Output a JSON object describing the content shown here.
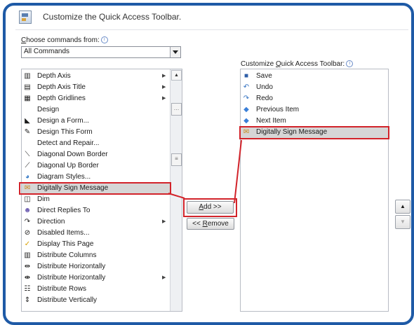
{
  "header": {
    "title": "Customize the Quick Access Toolbar."
  },
  "choose": {
    "label_prefix": "",
    "label_access_key": "C",
    "label_rest": "hoose commands from:",
    "selected": "All Commands"
  },
  "right_panel": {
    "label_prefix": "Customize ",
    "label_access_key": "Q",
    "label_rest": "uick Access Toolbar:"
  },
  "commands": [
    {
      "label": "Depth Axis",
      "icon": "axis-icon",
      "submenu": true
    },
    {
      "label": "Depth Axis Title",
      "icon": "axis-title-icon",
      "submenu": true
    },
    {
      "label": "Depth Gridlines",
      "icon": "gridlines-icon",
      "submenu": true
    },
    {
      "label": "Design",
      "icon": "",
      "submenu": false
    },
    {
      "label": "Design a Form...",
      "icon": "form-icon",
      "submenu": false
    },
    {
      "label": "Design This Form",
      "icon": "design-form-icon",
      "submenu": false
    },
    {
      "label": "Detect and Repair...",
      "icon": "",
      "submenu": false
    },
    {
      "label": "Diagonal Down Border",
      "icon": "diag-down-icon",
      "submenu": false
    },
    {
      "label": "Diagonal Up Border",
      "icon": "diag-up-icon",
      "submenu": false
    },
    {
      "label": "Diagram Styles...",
      "icon": "diagram-icon",
      "submenu": false
    },
    {
      "label": "Digitally Sign Message",
      "icon": "certificate-icon",
      "submenu": false,
      "selected": true
    },
    {
      "label": "Dim",
      "icon": "dim-icon",
      "submenu": false
    },
    {
      "label": "Direct Replies To",
      "icon": "people-icon",
      "submenu": false
    },
    {
      "label": "Direction",
      "icon": "direction-icon",
      "submenu": true
    },
    {
      "label": "Disabled Items...",
      "icon": "disabled-icon",
      "submenu": false
    },
    {
      "label": "Display This Page",
      "icon": "check-icon",
      "submenu": false
    },
    {
      "label": "Distribute Columns",
      "icon": "columns-icon",
      "submenu": false
    },
    {
      "label": "Distribute Horizontally",
      "icon": "dist-h-icon",
      "submenu": false
    },
    {
      "label": "Distribute Horizontally",
      "icon": "dist-h2-icon",
      "submenu": true
    },
    {
      "label": "Distribute Rows",
      "icon": "rows-icon",
      "submenu": false
    },
    {
      "label": "Distribute Vertically",
      "icon": "dist-v-icon",
      "submenu": false
    }
  ],
  "toolbar_items": [
    {
      "label": "Save",
      "icon": "save-icon"
    },
    {
      "label": "Undo",
      "icon": "undo-icon"
    },
    {
      "label": "Redo",
      "icon": "redo-icon"
    },
    {
      "label": "Previous Item",
      "icon": "up-arrow-icon"
    },
    {
      "label": "Next Item",
      "icon": "down-arrow-icon"
    },
    {
      "label": "Digitally Sign Message",
      "icon": "certificate-icon",
      "selected": true
    }
  ],
  "buttons": {
    "add_access_key": "A",
    "add_rest": "dd >>",
    "remove_prefix": "<< ",
    "remove_access_key": "R",
    "remove_rest": "emove"
  },
  "colors": {
    "highlight": "#d2232a",
    "frame": "#1e5aa6",
    "selection": "#d6d6d6"
  }
}
